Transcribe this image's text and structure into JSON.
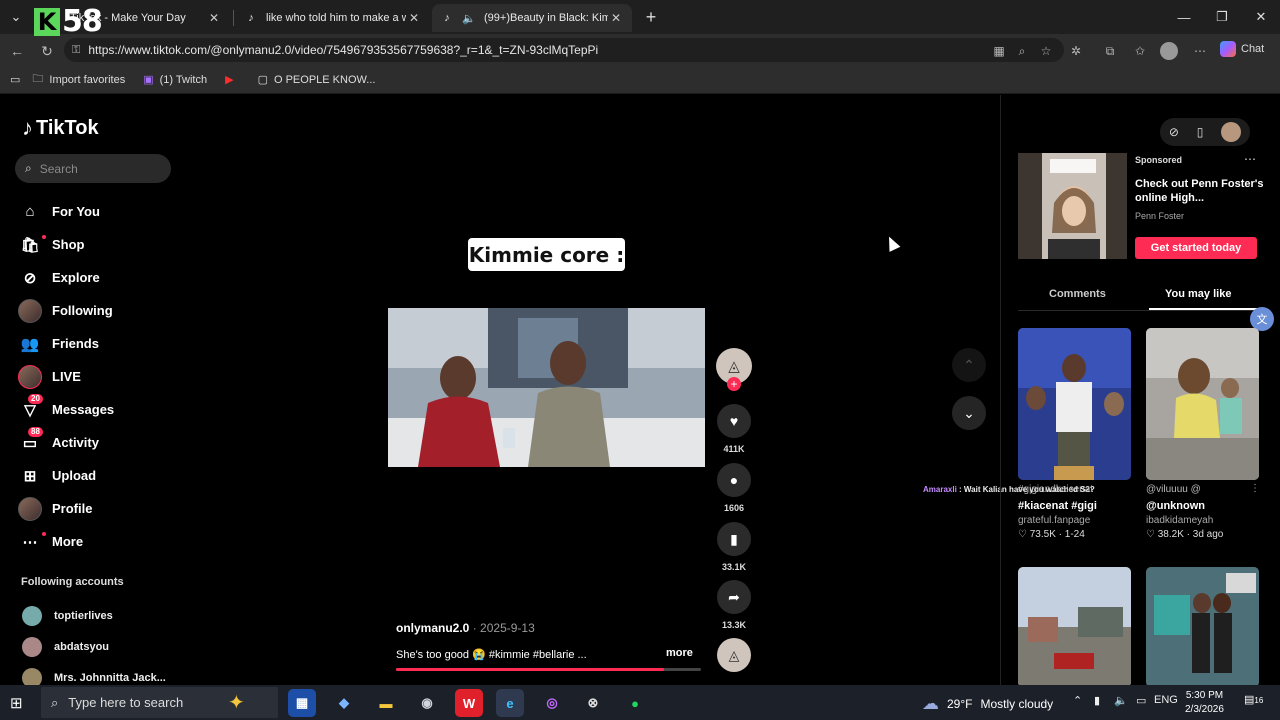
{
  "overlay": {
    "badge_letter": "K",
    "badge_number": "58"
  },
  "browser": {
    "tabs": [
      {
        "title": "TikTok - Make Your Day",
        "active": false
      },
      {
        "title": "like who told him to make a whole",
        "active": false
      },
      {
        "title": "(99+)Beauty in Black: Kimmie",
        "active": true
      }
    ],
    "url": "https://www.tiktok.com/@onlymanu2.0/video/7549679353567759638?_r=1&_t=ZN-93clMqTepPi",
    "chat_label": "Chat",
    "bookmarks": [
      {
        "label": "Import favorites",
        "icon": "folder-icon"
      },
      {
        "label": "(1) Twitch",
        "icon": "twitch-icon"
      },
      {
        "label": "",
        "icon": "youtube-icon"
      },
      {
        "label": "O PEOPLE KNOW...",
        "icon": "page-icon"
      }
    ]
  },
  "tiktok": {
    "logo": "TikTok",
    "search_placeholder": "Search",
    "nav": [
      {
        "label": "For You",
        "icon": "home-icon"
      },
      {
        "label": "Shop",
        "icon": "shop-icon"
      },
      {
        "label": "Explore",
        "icon": "compass-icon"
      },
      {
        "label": "Following",
        "icon": "following-avatar-icon"
      },
      {
        "label": "Friends",
        "icon": "friends-icon"
      },
      {
        "label": "LIVE",
        "icon": "live-avatar-icon"
      },
      {
        "label": "Messages",
        "icon": "messages-icon",
        "badge": "20"
      },
      {
        "label": "Activity",
        "icon": "inbox-icon",
        "badge": "88"
      },
      {
        "label": "Upload",
        "icon": "upload-icon"
      },
      {
        "label": "Profile",
        "icon": "profile-avatar-icon"
      },
      {
        "label": "More",
        "icon": "more-icon"
      }
    ],
    "following_heading": "Following accounts",
    "following": [
      "toptierlives",
      "abdatsyou",
      "Mrs. Johnnitta Jack..."
    ],
    "video": {
      "caption_text": "Kimmie core :",
      "creator": "onlymanu2.0",
      "date": "2025-9-13",
      "description": "She's too good 😭 #kimmie #bellarie ...",
      "more_label": "more",
      "progress": 0.88,
      "likes": "411K",
      "comments": "1606",
      "saves": "33.1K",
      "shares": "13.3K"
    },
    "ad": {
      "sponsored": "Sponsored",
      "title": "Check out Penn Foster's online High...",
      "advertiser": "Penn Foster",
      "cta": "Get started today"
    },
    "panel_tabs": [
      "Comments",
      "You may like"
    ],
    "chat_ticker": {
      "name": "Amaraxli",
      "text": " : Wait Kalian have you watched S2?"
    },
    "recommendations": [
      {
        "handle": "#gigiandkaicenat",
        "title": "#kiacenat #gigi",
        "author": "grateful.fanpage",
        "stats": "♡ 73.5K · 1-24"
      },
      {
        "handle": "@viluuuu @",
        "title": "@unknown",
        "author": "ibadkidameyah",
        "stats": "♡ 38.2K · 3d ago"
      },
      {
        "handle": "",
        "title": "",
        "author": "",
        "stats": ""
      },
      {
        "handle": "",
        "title": "",
        "author": "",
        "stats": ""
      }
    ]
  },
  "taskbar": {
    "search_placeholder": "Type here to search",
    "weather_temp": "29°F",
    "weather_text": "Mostly cloudy",
    "lang": "ENG",
    "time": "5:30 PM",
    "date": "2/3/2026",
    "notifications": "16"
  }
}
